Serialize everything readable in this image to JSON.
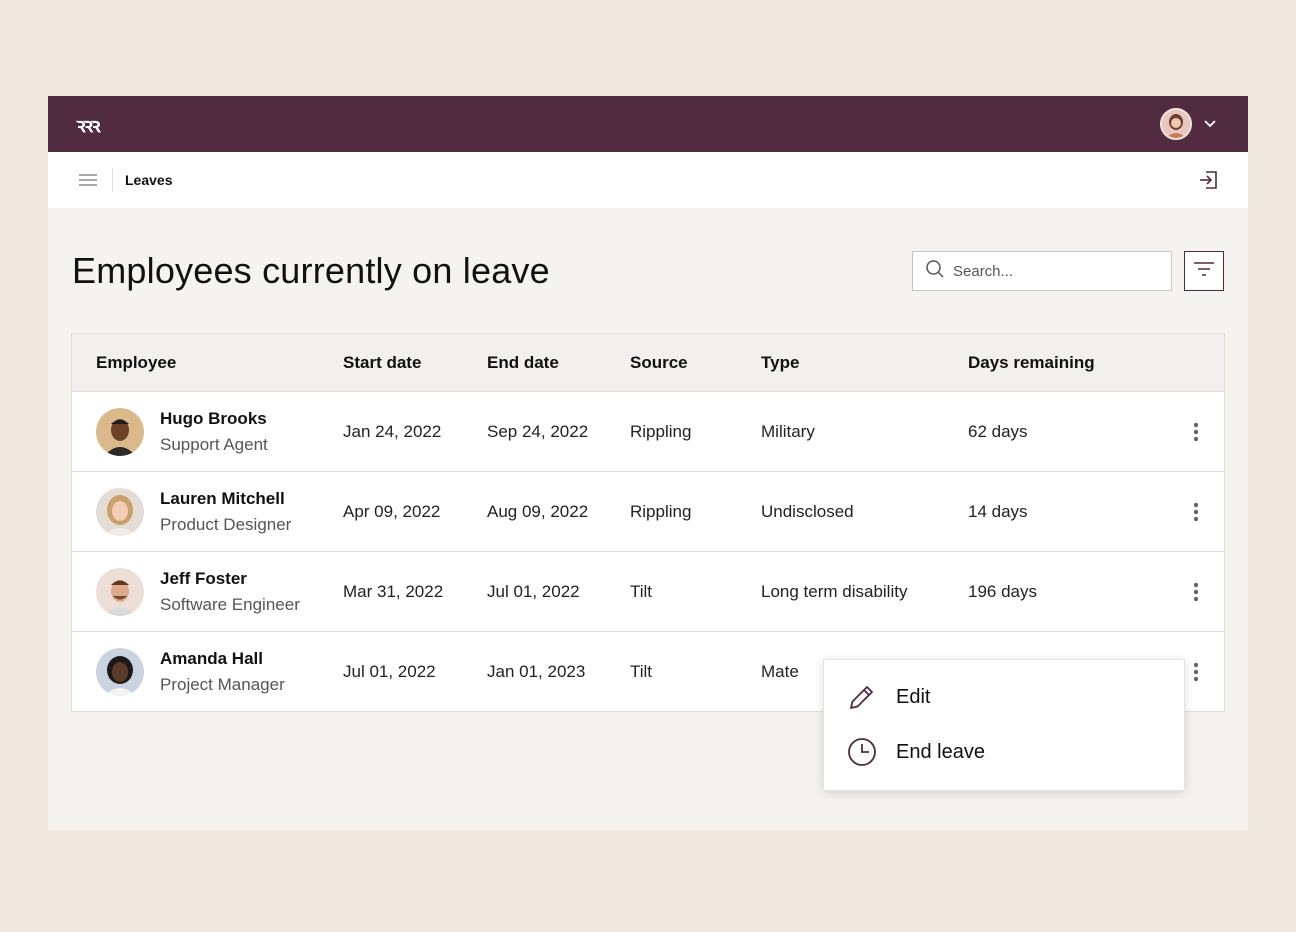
{
  "header": {
    "logo_text": "ꝛꝛꝛ",
    "brand_color": "#512b3f"
  },
  "subbar": {
    "breadcrumb": "Leaves"
  },
  "page": {
    "title": "Employees currently on leave",
    "search_placeholder": "Search..."
  },
  "table": {
    "columns": [
      "Employee",
      "Start date",
      "End date",
      "Source",
      "Type",
      "Days remaining"
    ],
    "rows": [
      {
        "name": "Hugo Brooks",
        "role": "Support Agent",
        "start": "Jan 24, 2022",
        "end": "Sep 24, 2022",
        "source": "Rippling",
        "type": "Military",
        "days": "62 days"
      },
      {
        "name": "Lauren Mitchell",
        "role": "Product Designer",
        "start": "Apr 09, 2022",
        "end": "Aug 09, 2022",
        "source": "Rippling",
        "type": "Undisclosed",
        "days": "14 days"
      },
      {
        "name": "Jeff Foster",
        "role": "Software Engineer",
        "start": "Mar 31, 2022",
        "end": "Jul 01, 2022",
        "source": "Tilt",
        "type": "Long term disability",
        "days": "196 days"
      },
      {
        "name": "Amanda Hall",
        "role": "Project Manager",
        "start": "Jul 01, 2022",
        "end": "Jan 01, 2023",
        "source": "Tilt",
        "type": "Mate",
        "days": ""
      }
    ]
  },
  "popover": {
    "items": [
      {
        "label": "Edit",
        "icon": "pencil-icon"
      },
      {
        "label": "End leave",
        "icon": "clock-icon"
      }
    ]
  }
}
